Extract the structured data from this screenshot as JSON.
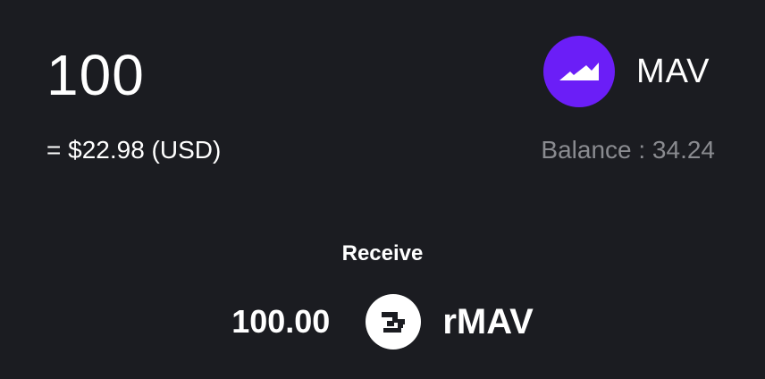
{
  "swap": {
    "amount_input_value": "100",
    "usd_value": "= $22.98 (USD)",
    "balance": "Balance : 34.24",
    "from_token": {
      "symbol": "MAV",
      "icon": "maverick-logo-icon",
      "color": "#6b1ef7"
    }
  },
  "receive": {
    "label": "Receive",
    "amount": "100.00",
    "token": {
      "symbol": "rMAV",
      "icon": "rmav-logo-icon",
      "color": "#ffffff"
    }
  },
  "colors": {
    "background": "#1b1c21",
    "text_primary": "#ffffff",
    "text_muted": "#8a8b90",
    "accent": "#6b1ef7"
  }
}
